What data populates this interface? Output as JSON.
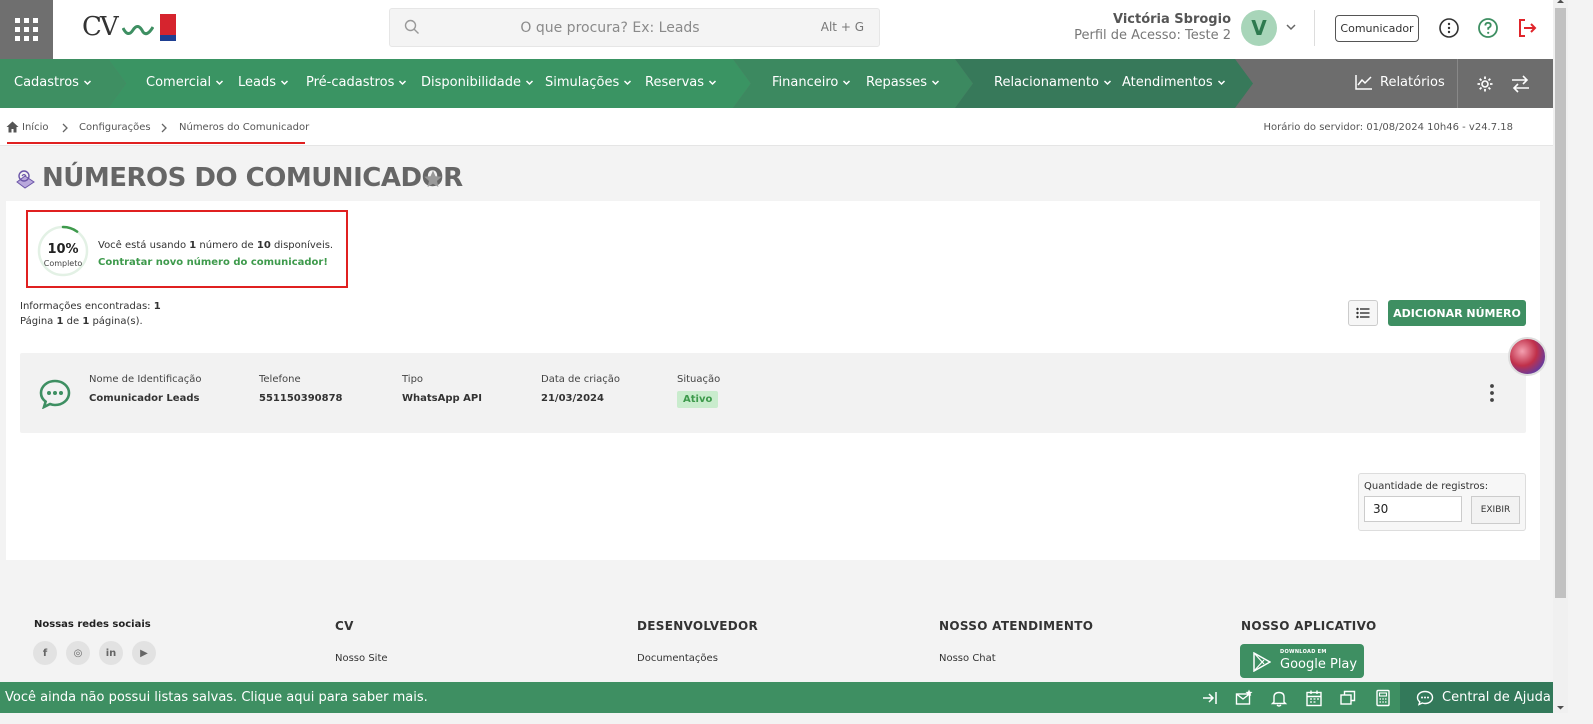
{
  "header": {
    "search_placeholder": "O que procura? Ex: Leads",
    "search_shortcut": "Alt + G",
    "user_name": "Victória Sbrogio",
    "user_profile": "Perfil de Acesso: Teste 2",
    "avatar_letter": "V",
    "comunicador_label": "Comunicador",
    "logo_text": "CV"
  },
  "nav": {
    "items": [
      {
        "label": "Cadastros"
      },
      {
        "label": "Comercial"
      },
      {
        "label": "Leads"
      },
      {
        "label": "Pré-cadastros"
      },
      {
        "label": "Disponibilidade"
      },
      {
        "label": "Simulações"
      },
      {
        "label": "Reservas"
      },
      {
        "label": "Financeiro"
      },
      {
        "label": "Repasses"
      },
      {
        "label": "Relacionamento"
      },
      {
        "label": "Atendimentos"
      }
    ],
    "reports_label": "Relatórios",
    "colors": {
      "seg1": "#3e8f62",
      "seg2": "#3a9463",
      "seg3": "#3c8960",
      "seg4": "#37795a",
      "gray": "#6d6d6d"
    }
  },
  "breadcrumb": {
    "items": [
      "Início",
      "Configurações",
      "Números do Comunicador"
    ],
    "server_time": "Horário do servidor: 01/08/2024 10h46 - v24.7.18"
  },
  "page": {
    "title": "NÚMEROS DO COMUNICADOR"
  },
  "usage": {
    "percent": "10%",
    "percent_value": 0.1,
    "percent_label": "Completo",
    "text_before": "Você está usando ",
    "used": "1",
    "text_mid": " número de ",
    "total": "10",
    "text_after": " disponíveis.",
    "link": "Contratar novo número do comunicador!"
  },
  "results": {
    "found_label": "Informações encontradas: ",
    "found_count": "1",
    "page_label_1": "Página ",
    "page_current": "1",
    "page_label_2": " de ",
    "page_total": "1",
    "page_label_3": " página(s)."
  },
  "add_button_label": "ADICIONAR NÚMERO",
  "record": {
    "columns": [
      {
        "label": "Nome de Identificação",
        "value": "Comunicador Leads"
      },
      {
        "label": "Telefone",
        "value": "551150390878"
      },
      {
        "label": "Tipo",
        "value": "WhatsApp API"
      },
      {
        "label": "Data de criação",
        "value": "21/03/2024"
      },
      {
        "label": "Situação",
        "value": "Ativo"
      }
    ]
  },
  "quantity": {
    "label": "Quantidade de registros:",
    "value": "30",
    "button": "EXIBIR"
  },
  "footer": {
    "social_title": "Nossas redes sociais",
    "social_icons": [
      "f",
      "◎",
      "in",
      "▶"
    ],
    "columns": [
      {
        "title": "CV",
        "link": "Nosso Site"
      },
      {
        "title": "DESENVOLVEDOR",
        "link": "Documentações"
      },
      {
        "title": "NOSSO ATENDIMENTO",
        "link": "Nosso Chat"
      },
      {
        "title": "NOSSO APLICATIVO",
        "link": ""
      }
    ],
    "gplay_small": "DOWNLOAD EM",
    "gplay_big": "Google Play"
  },
  "bottombar": {
    "message": "Você ainda não possui listas salvas. Clique aqui para saber mais.",
    "help_label": "Central de Ajuda"
  }
}
